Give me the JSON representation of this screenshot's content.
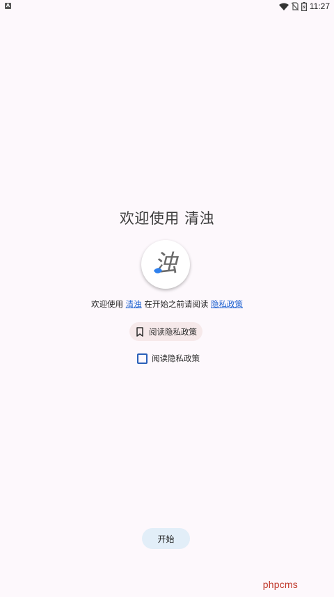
{
  "status_bar": {
    "time": "11:27",
    "icons": [
      "wifi-icon",
      "no-sim-icon",
      "battery-icon"
    ]
  },
  "main": {
    "title": "欢迎使用 清浊",
    "logo_glyph": "浊",
    "intro": {
      "prefix": "欢迎使用",
      "app_name": "清浊",
      "middle": "在开始之前请阅读",
      "policy_link": "隐私政策"
    },
    "read_policy_label": "阅读隐私政策",
    "agree_checkbox_label": "阅读隐私政策",
    "agree_checked": false,
    "start_label": "开始"
  },
  "watermark": "phpcms",
  "colors": {
    "background": "#fdf8fc",
    "link": "#1a5fd0",
    "chip_bg": "#f6e9ea",
    "checkbox_border": "#2a5fb8",
    "start_bg": "#e2eef8",
    "watermark": "#c0392b"
  }
}
